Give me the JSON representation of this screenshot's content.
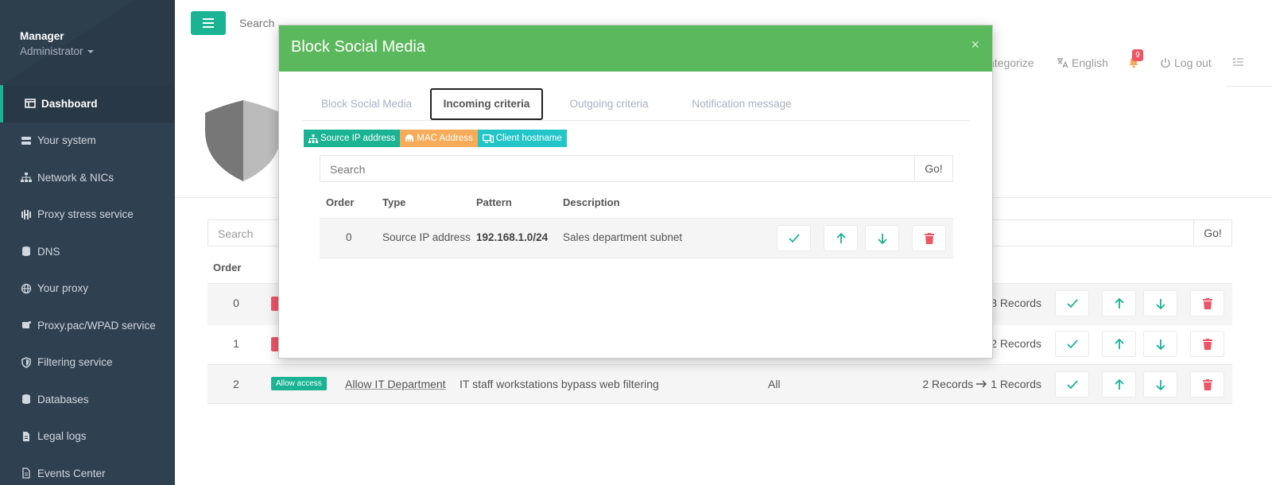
{
  "sidebar": {
    "user_name": "Manager",
    "user_role": "Administrator",
    "items": [
      {
        "label": "Dashboard",
        "icon": "dashboard-icon",
        "active": true
      },
      {
        "label": "Your system",
        "icon": "server-icon"
      },
      {
        "label": "Network & NICs",
        "icon": "network-icon"
      },
      {
        "label": "Proxy stress service",
        "icon": "stress-icon"
      },
      {
        "label": "DNS",
        "icon": "database-icon"
      },
      {
        "label": "Your proxy",
        "icon": "globe-icon"
      },
      {
        "label": "Proxy.pac/WPAD service",
        "icon": "scroll-icon"
      },
      {
        "label": "Filtering service",
        "icon": "shield-icon"
      },
      {
        "label": "Databases",
        "icon": "database-icon"
      },
      {
        "label": "Legal logs",
        "icon": "file-icon"
      },
      {
        "label": "Events Center",
        "icon": "list-icon"
      }
    ]
  },
  "topbar": {
    "search_placeholder": "Search",
    "categorize_label": "ategorize",
    "language_label": "English",
    "notification_count": "9",
    "logout_label": "Log out"
  },
  "background": {
    "search_placeholder": "Search",
    "go_label": "Go!",
    "order_header": "Order",
    "rows": [
      {
        "order": "0",
        "records_from": "",
        "records_to": "3 Records"
      },
      {
        "order": "1",
        "records_from": "",
        "records_to": "2 Records"
      },
      {
        "order": "2",
        "badge": "Allow access",
        "name": "Allow IT Department",
        "description": "IT staff workstations bypass web filtering",
        "scope": "All",
        "records_from": "2 Records",
        "records_to": "1 Records"
      }
    ]
  },
  "modal": {
    "title": "Block Social Media",
    "close_symbol": "×",
    "tabs": [
      "Block Social Media",
      "Incoming criteria",
      "Outgoing criteria",
      "Notification message"
    ],
    "active_tab": 1,
    "chips": [
      {
        "label": "Source IP address",
        "color": "#1ab394",
        "icon": "sitemap-icon"
      },
      {
        "label": "MAC Address",
        "color": "#f8ac59",
        "icon": "mac-icon"
      },
      {
        "label": "Client hostname",
        "color": "#23c6c8",
        "icon": "computer-icon"
      }
    ],
    "search_placeholder": "Search",
    "go_label": "Go!",
    "columns": [
      "Order",
      "Type",
      "Pattern",
      "Description"
    ],
    "rows": [
      {
        "order": "0",
        "type": "Source IP address",
        "pattern": "192.168.1.0/24",
        "description": "Sales department subnet"
      }
    ]
  },
  "colors": {
    "accent": "#1ab394",
    "modal_header": "#5cb85c",
    "danger": "#ed5565",
    "sidebar": "#2f4050"
  }
}
